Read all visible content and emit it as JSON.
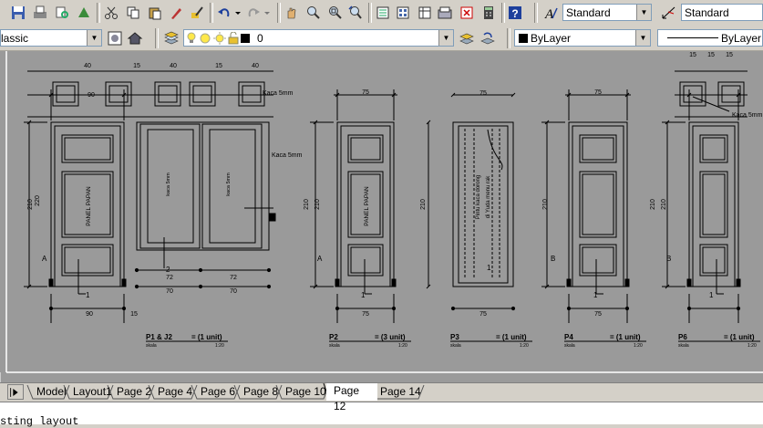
{
  "toolbar": {
    "text_style": "Standard",
    "dim_style": "Standard",
    "workspace": "lassic",
    "layer_current": "0",
    "color_control": "ByLayer",
    "linetype_control": "ByLayer"
  },
  "icons": [
    "save-icon",
    "plot-icon",
    "plot-preview-icon",
    "publish-icon",
    "cut-icon",
    "copy-icon",
    "paste-icon",
    "match-properties-icon",
    "block-editor-icon",
    "undo-icon",
    "redo-icon",
    "pan-icon",
    "zoom-realtime-icon",
    "zoom-window-icon",
    "zoom-previous-icon",
    "properties-icon",
    "design-center-icon",
    "tool-palettes-icon",
    "sheet-set-icon",
    "markup-icon",
    "calculator-icon",
    "help-icon",
    "text-style-icon",
    "dim-style-icon",
    "workspace-settings-icon",
    "workspace-home-icon",
    "layer-properties-icon",
    "make-object-layer-current-icon",
    "layer-previous-icon"
  ],
  "layout_tabs": [
    "Model",
    "Layout1",
    "Page 2",
    "Page 4",
    "Page 6",
    "Page 8",
    "Page 10",
    "Page 12",
    "Page 14"
  ],
  "active_tab": "Page 12",
  "command_line": "sting layout",
  "drawing": {
    "dims_small": [
      "40",
      "15",
      "40",
      "15",
      "40",
      "15",
      "15",
      "15"
    ],
    "dims_top": [
      "90",
      "75",
      "75",
      "75"
    ],
    "dims_height": [
      "210",
      "220",
      "210",
      "210",
      "210",
      "210",
      "210",
      "210"
    ],
    "dims_bottom": [
      "90",
      "75",
      "75",
      "75",
      "15",
      "70",
      "70",
      "72",
      "72"
    ],
    "panel_labels": [
      "PANEL PAPAN",
      "PANEL PAPAN"
    ],
    "glass_labels": [
      "kaca 5mm",
      "kaca 5mm"
    ],
    "annotations": [
      "Kaca 5mm",
      "Kaca 5mm",
      "Kaca 5mm"
    ],
    "sliding_label_1": "Pintu kaca dorong",
    "sliding_label_2": "di Yuda menu rak",
    "section_marks": [
      "A",
      "A",
      "B",
      "B"
    ],
    "callout_numbers": [
      "1",
      "1",
      "1",
      "1",
      "1",
      "2"
    ],
    "door_titles": [
      {
        "code": "P1 & J2",
        "qty": "= (1 unit)",
        "sub": "skala",
        "scale": "1:20"
      },
      {
        "code": "P2",
        "qty": "= (3 unit)",
        "sub": "skala",
        "scale": "1:20"
      },
      {
        "code": "P3",
        "qty": "= (1 unit)",
        "sub": "skala",
        "scale": "1:20"
      },
      {
        "code": "P4",
        "qty": "= (1 unit)",
        "sub": "skala",
        "scale": "1:20"
      },
      {
        "code": "P6",
        "qty": "= (1 unit)",
        "sub": "skala",
        "scale": "1:20"
      }
    ]
  }
}
